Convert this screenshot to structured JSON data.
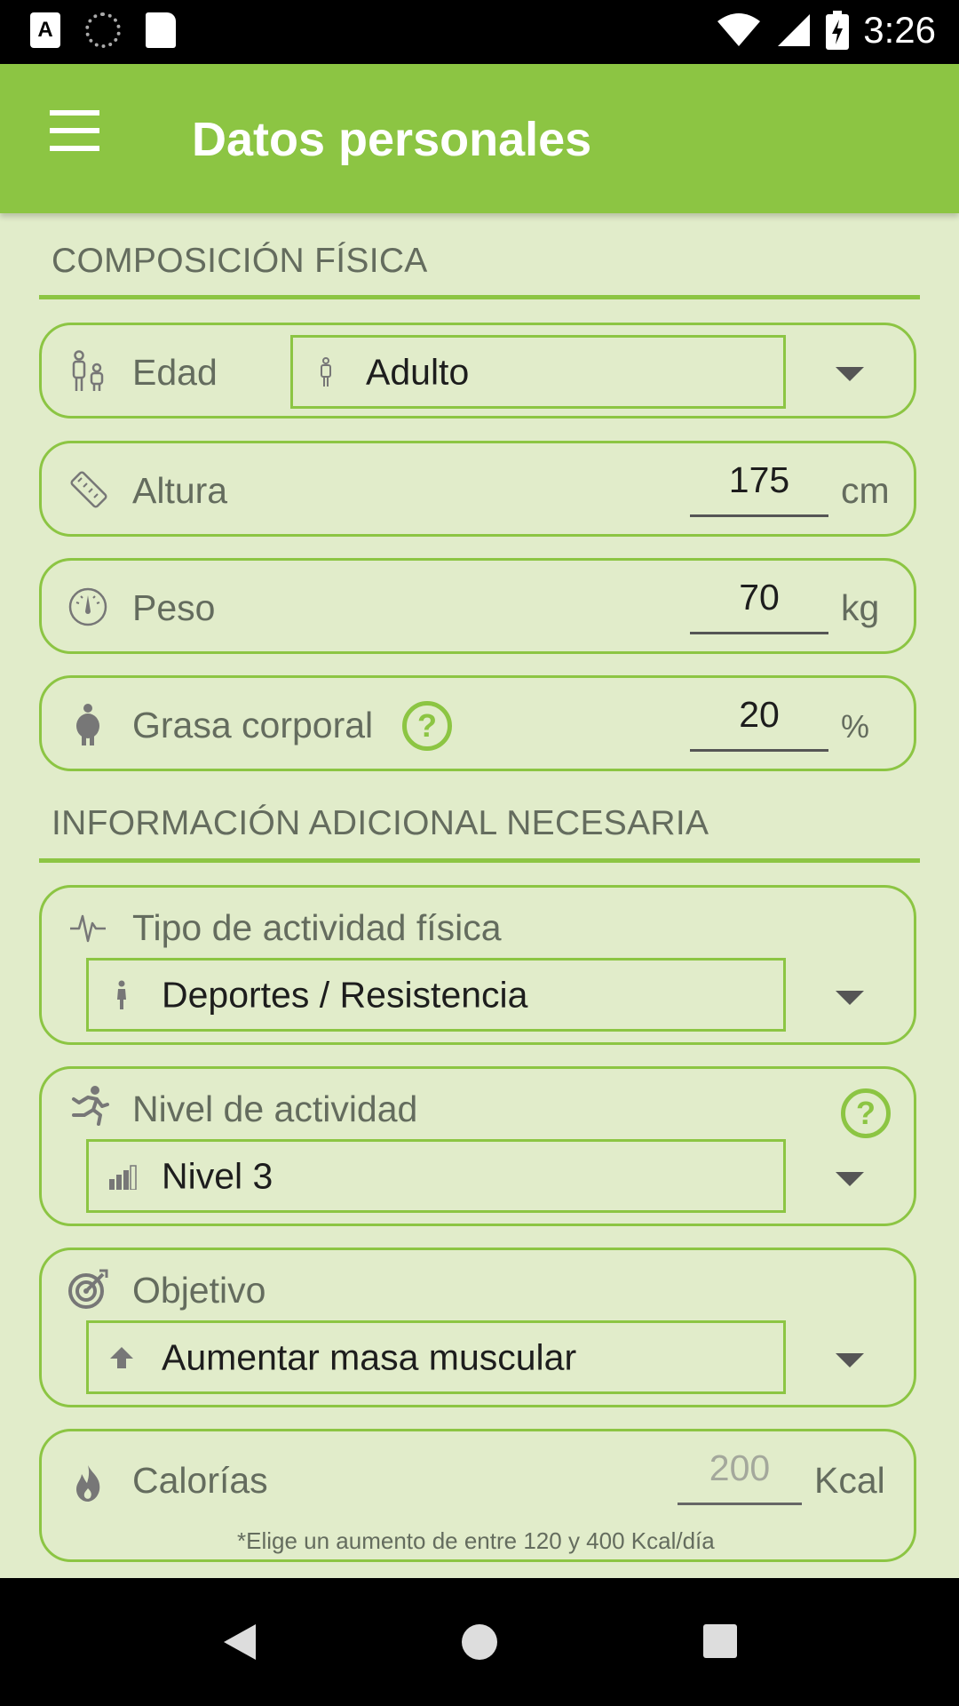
{
  "status_bar": {
    "time": "3:26",
    "badge_letter": "A"
  },
  "app_bar": {
    "title": "Datos personales"
  },
  "sections": {
    "physical": "COMPOSICIÓN FÍSICA",
    "additional": "INFORMACIÓN ADICIONAL NECESARIA"
  },
  "age": {
    "label": "Edad",
    "value": "Adulto"
  },
  "height": {
    "label": "Altura",
    "value": "175",
    "unit": "cm"
  },
  "weight": {
    "label": "Peso",
    "value": "70",
    "unit": "kg"
  },
  "body_fat": {
    "label": "Grasa corporal",
    "value": "20",
    "unit": "%"
  },
  "activity_type": {
    "label": "Tipo de actividad física",
    "value": "Deportes / Resistencia"
  },
  "activity_level": {
    "label": "Nivel de actividad",
    "value": "Nivel 3"
  },
  "goal": {
    "label": "Objetivo",
    "value": "Aumentar masa muscular"
  },
  "calories": {
    "label": "Calorías",
    "placeholder": "200",
    "unit": "Kcal",
    "note": "*Elige un aumento de entre 120 y 400 Kcal/día"
  },
  "help_symbol": "?",
  "colors": {
    "accent": "#8cc543",
    "background": "#e1ecca",
    "text": "#646c5e"
  },
  "icons": {
    "menu": "hamburger-icon",
    "age": "family-icon",
    "height": "tape-measure-icon",
    "weight": "scale-icon",
    "body_fat": "body-icon",
    "activity_type": "pulse-icon",
    "activity_level": "running-icon",
    "goal": "target-icon",
    "calories": "flame-icon"
  }
}
